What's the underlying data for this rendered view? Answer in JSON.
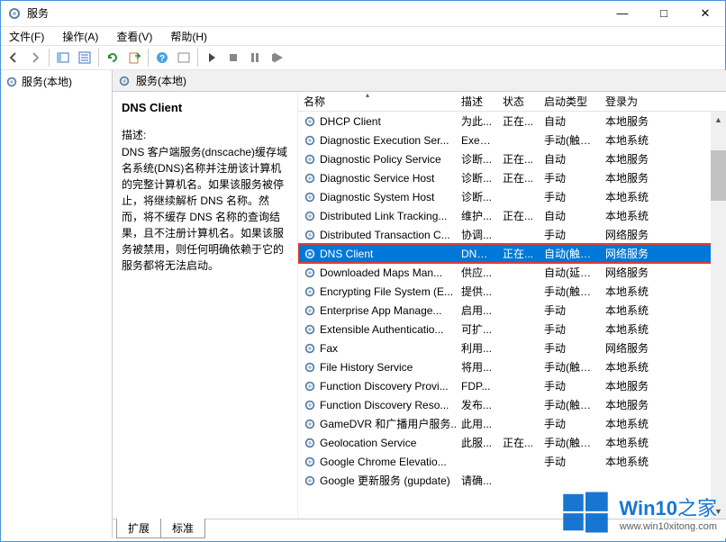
{
  "window": {
    "title": "服务",
    "min": "—",
    "max": "□",
    "close": "✕"
  },
  "menu": {
    "file": "文件(F)",
    "action": "操作(A)",
    "view": "查看(V)",
    "help": "帮助(H)"
  },
  "tree": {
    "root": "服务(本地)"
  },
  "pane": {
    "header": "服务(本地)"
  },
  "detail": {
    "name": "DNS Client",
    "desc_label": "描述:",
    "desc": "DNS 客户端服务(dnscache)缓存域名系统(DNS)名称并注册该计算机的完整计算机名。如果该服务被停止，将继续解析 DNS 名称。然而，将不缓存 DNS 名称的查询结果，且不注册计算机名。如果该服务被禁用，则任何明确依赖于它的服务都将无法启动。"
  },
  "columns": {
    "name": "名称",
    "desc": "描述",
    "stat": "状态",
    "start": "启动类型",
    "logon": "登录为"
  },
  "tabs": {
    "extended": "扩展",
    "standard": "标准"
  },
  "watermark": {
    "brand_a": "Win10",
    "brand_b": "之家",
    "url": "www.win10xitong.com"
  },
  "services": [
    {
      "name": "DHCP Client",
      "desc": "为此...",
      "stat": "正在...",
      "start": "自动",
      "logon": "本地服务"
    },
    {
      "name": "Diagnostic Execution Ser...",
      "desc": "Exec...",
      "stat": "",
      "start": "手动(触发...",
      "logon": "本地系统"
    },
    {
      "name": "Diagnostic Policy Service",
      "desc": "诊断...",
      "stat": "正在...",
      "start": "自动",
      "logon": "本地服务"
    },
    {
      "name": "Diagnostic Service Host",
      "desc": "诊断...",
      "stat": "正在...",
      "start": "手动",
      "logon": "本地服务"
    },
    {
      "name": "Diagnostic System Host",
      "desc": "诊断...",
      "stat": "",
      "start": "手动",
      "logon": "本地系统"
    },
    {
      "name": "Distributed Link Tracking...",
      "desc": "维护...",
      "stat": "正在...",
      "start": "自动",
      "logon": "本地系统"
    },
    {
      "name": "Distributed Transaction C...",
      "desc": "协调...",
      "stat": "",
      "start": "手动",
      "logon": "网络服务"
    },
    {
      "name": "DNS Client",
      "desc": "DNS...",
      "stat": "正在...",
      "start": "自动(触发...",
      "logon": "网络服务",
      "selected": true,
      "highlight": true
    },
    {
      "name": "Downloaded Maps Man...",
      "desc": "供应...",
      "stat": "",
      "start": "自动(延迟...",
      "logon": "网络服务"
    },
    {
      "name": "Encrypting File System (E...",
      "desc": "提供...",
      "stat": "",
      "start": "手动(触发...",
      "logon": "本地系统"
    },
    {
      "name": "Enterprise App Manage...",
      "desc": "启用...",
      "stat": "",
      "start": "手动",
      "logon": "本地系统"
    },
    {
      "name": "Extensible Authenticatio...",
      "desc": "可扩...",
      "stat": "",
      "start": "手动",
      "logon": "本地系统"
    },
    {
      "name": "Fax",
      "desc": "利用...",
      "stat": "",
      "start": "手动",
      "logon": "网络服务"
    },
    {
      "name": "File History Service",
      "desc": "将用...",
      "stat": "",
      "start": "手动(触发...",
      "logon": "本地系统"
    },
    {
      "name": "Function Discovery Provi...",
      "desc": "FDP...",
      "stat": "",
      "start": "手动",
      "logon": "本地服务"
    },
    {
      "name": "Function Discovery Reso...",
      "desc": "发布...",
      "stat": "",
      "start": "手动(触发...",
      "logon": "本地服务"
    },
    {
      "name": "GameDVR 和广播用户服务...",
      "desc": "此用...",
      "stat": "",
      "start": "手动",
      "logon": "本地系统"
    },
    {
      "name": "Geolocation Service",
      "desc": "此服...",
      "stat": "正在...",
      "start": "手动(触发...",
      "logon": "本地系统"
    },
    {
      "name": "Google Chrome Elevatio...",
      "desc": "",
      "stat": "",
      "start": "手动",
      "logon": "本地系统"
    },
    {
      "name": "Google 更新服务 (gupdate)",
      "desc": "请确...",
      "stat": "",
      "start": "",
      "logon": ""
    }
  ]
}
